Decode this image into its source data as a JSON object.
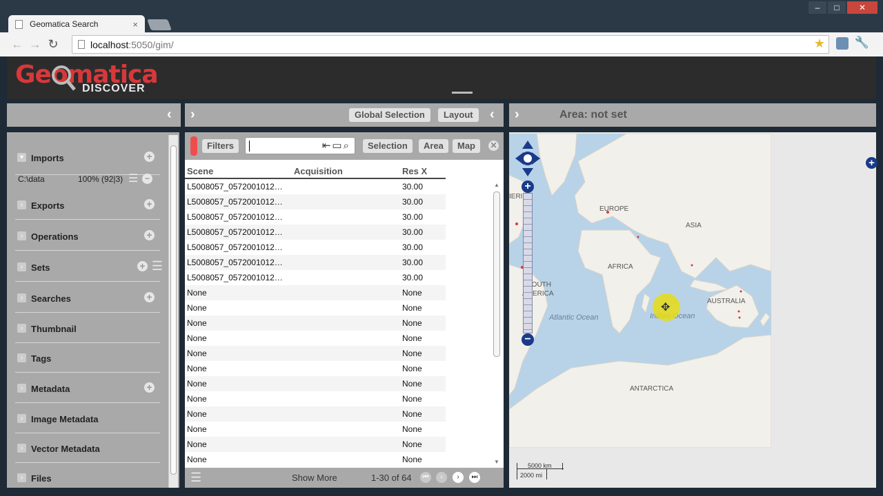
{
  "browser": {
    "tab_title": "Geomatica Search",
    "tab_close": "×",
    "url_host": "localhost",
    "url_rest": ":5050/gim/",
    "window_controls": [
      "–",
      "□",
      "✕"
    ]
  },
  "app": {
    "logo_main": "Geomatica",
    "logo_sub": "DISCOVER"
  },
  "toolbar": {
    "global_selection": "Global Selection",
    "layout": "Layout",
    "area_status": "Area: not set"
  },
  "sidebar": {
    "imports": "Imports",
    "import_path": "C:\\data",
    "import_progress": "100% (92|3)",
    "exports": "Exports",
    "operations": "Operations",
    "sets": "Sets",
    "searches": "Searches",
    "thumbnail": "Thumbnail",
    "tags": "Tags",
    "metadata": "Metadata",
    "image_metadata": "Image Metadata",
    "vector_metadata": "Vector Metadata",
    "files": "Files"
  },
  "filters": {
    "filters_label": "Filters",
    "search_value": "",
    "selection": "Selection",
    "area": "Area",
    "map": "Map"
  },
  "table": {
    "columns": [
      "Scene",
      "Acquisition",
      "Res X"
    ],
    "rows": [
      [
        "L5008057_0572001012…",
        "",
        "30.00"
      ],
      [
        "L5008057_0572001012…",
        "",
        "30.00"
      ],
      [
        "L5008057_0572001012…",
        "",
        "30.00"
      ],
      [
        "L5008057_0572001012…",
        "",
        "30.00"
      ],
      [
        "L5008057_0572001012…",
        "",
        "30.00"
      ],
      [
        "L5008057_0572001012…",
        "",
        "30.00"
      ],
      [
        "L5008057_0572001012…",
        "",
        "30.00"
      ],
      [
        "None",
        "",
        "None"
      ],
      [
        "None",
        "",
        "None"
      ],
      [
        "None",
        "",
        "None"
      ],
      [
        "None",
        "",
        "None"
      ],
      [
        "None",
        "",
        "None"
      ],
      [
        "None",
        "",
        "None"
      ],
      [
        "None",
        "",
        "None"
      ],
      [
        "None",
        "",
        "None"
      ],
      [
        "None",
        "",
        "None"
      ],
      [
        "None",
        "",
        "None"
      ],
      [
        "None",
        "",
        "None"
      ],
      [
        "None",
        "",
        "None"
      ]
    ]
  },
  "pager": {
    "show_more": "Show More",
    "range": "1-30 of 64"
  },
  "map": {
    "labels": {
      "america": "IERICA",
      "europe": "EUROPE",
      "asia": "ASIA",
      "africa": "AFRICA",
      "south": "SOUTH",
      "america2": "AMERICA",
      "australia": "AUSTRALIA",
      "antarctica": "ANTARCTICA",
      "atlantic": "Atlantic Ocean",
      "indian": "Indian Ocean"
    },
    "scale_km": "5000 km",
    "scale_mi": "2000 mi",
    "colors": {
      "water": "#b8d3e8",
      "land": "#f2f0ea",
      "control": "#1a3a8a"
    }
  }
}
